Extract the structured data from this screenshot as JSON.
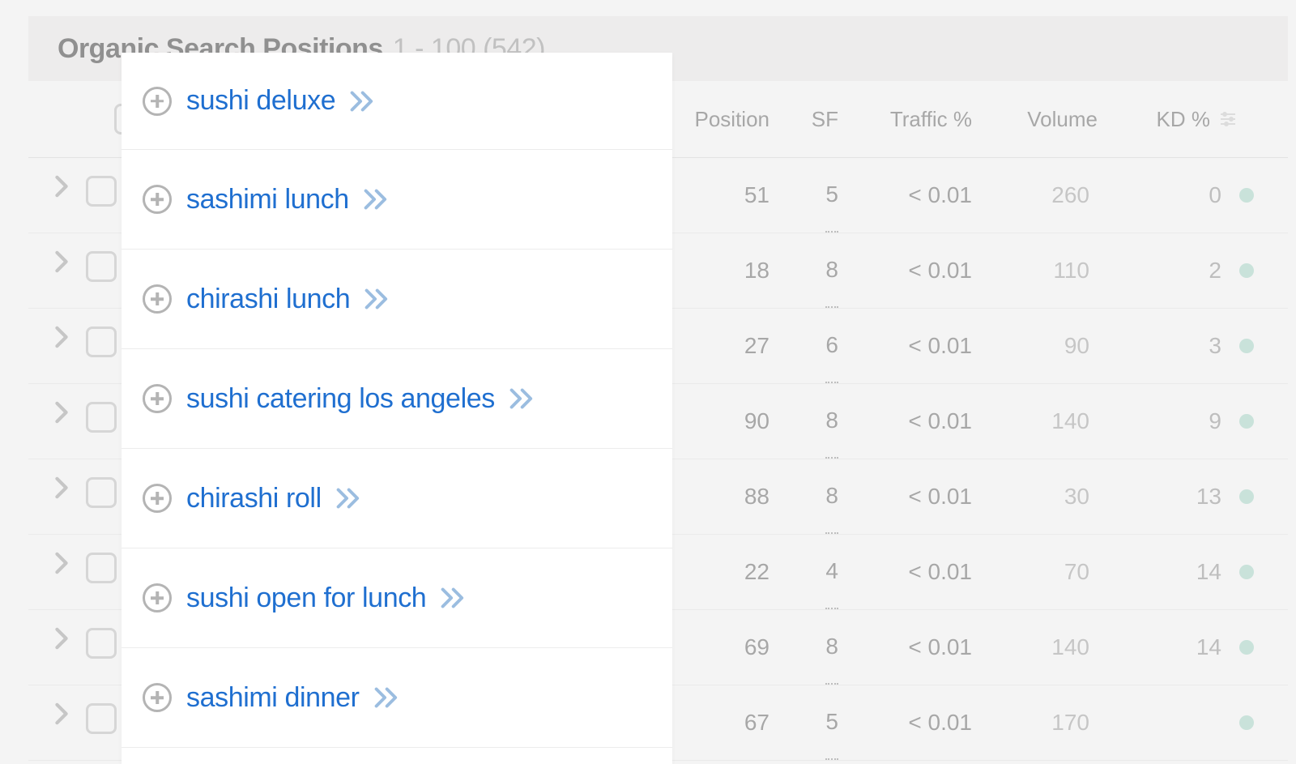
{
  "header": {
    "title": "Organic Search Positions",
    "range": "1 - 100 (542)"
  },
  "columns": {
    "position": "Position",
    "sf": "SF",
    "traffic": "Traffic %",
    "volume": "Volume",
    "kd": "KD %"
  },
  "rows": [
    {
      "position": "51",
      "sf": "5",
      "traffic": "< 0.01",
      "volume": "260",
      "kd": "0"
    },
    {
      "position": "18",
      "sf": "8",
      "traffic": "< 0.01",
      "volume": "110",
      "kd": "2"
    },
    {
      "position": "27",
      "sf": "6",
      "traffic": "< 0.01",
      "volume": "90",
      "kd": "3"
    },
    {
      "position": "90",
      "sf": "8",
      "traffic": "< 0.01",
      "volume": "140",
      "kd": "9"
    },
    {
      "position": "88",
      "sf": "8",
      "traffic": "< 0.01",
      "volume": "30",
      "kd": "13"
    },
    {
      "position": "22",
      "sf": "4",
      "traffic": "< 0.01",
      "volume": "70",
      "kd": "14"
    },
    {
      "position": "69",
      "sf": "8",
      "traffic": "< 0.01",
      "volume": "140",
      "kd": "14"
    },
    {
      "position": "67",
      "sf": "5",
      "traffic": "< 0.01",
      "volume": "170",
      "kd": ""
    }
  ],
  "popup_keywords": [
    "sushi deluxe",
    "sashimi lunch",
    "chirashi lunch",
    "sushi catering los angeles",
    "chirashi roll",
    "sushi open for lunch",
    "sashimi dinner"
  ]
}
